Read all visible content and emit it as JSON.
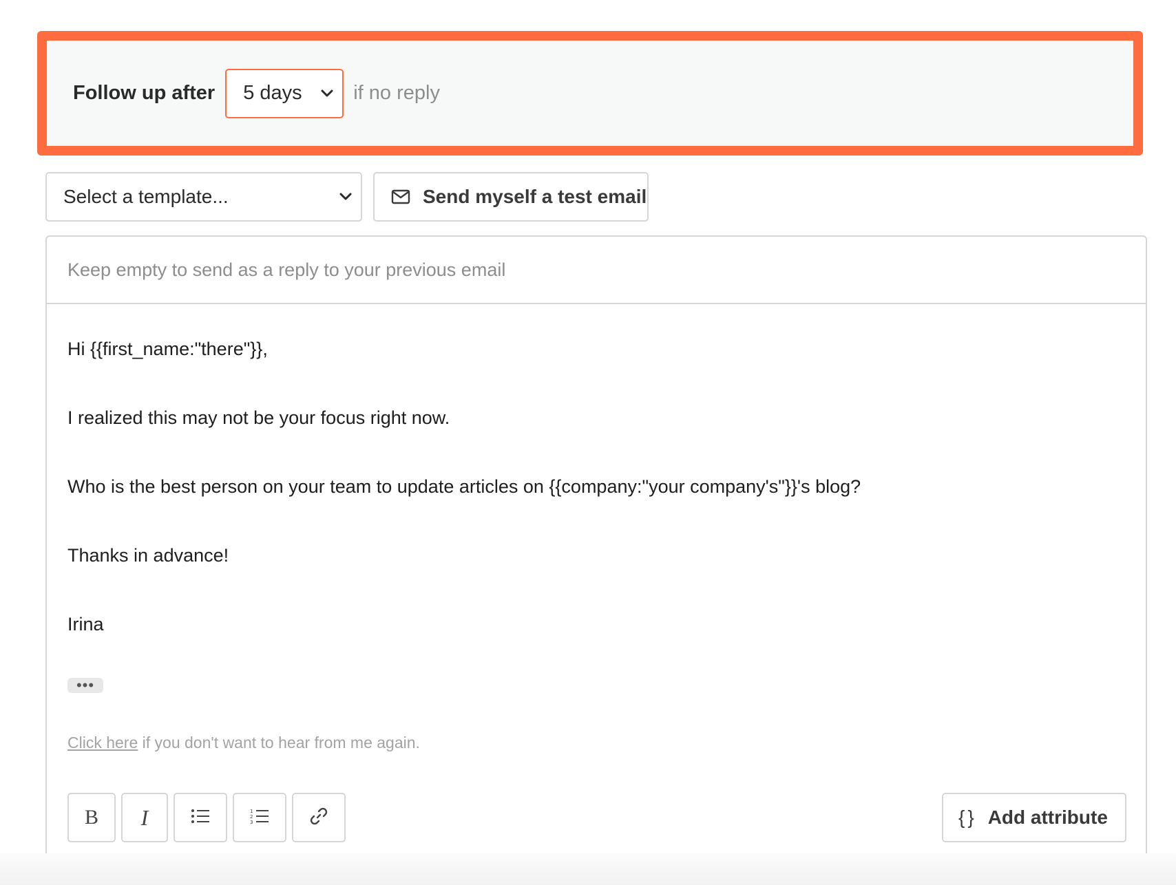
{
  "followup": {
    "label": "Follow up after",
    "delay_value": "5 days",
    "suffix": "if no reply"
  },
  "template": {
    "select_placeholder": "Select a template..."
  },
  "test_email": {
    "label": "Send myself a test email",
    "icon": "envelope-icon"
  },
  "editor": {
    "subject_placeholder": "Keep empty to send as a reply to your previous email",
    "body": [
      "Hi {{first_name:\"there\"}},",
      "I realized this may not be your focus right now.",
      "Who is the best person on your team to update articles on {{company:\"your company's\"}}'s blog?",
      "Thanks in advance!",
      "Irina"
    ],
    "ellipsis": "•••",
    "unsubscribe": {
      "link_text": "Click here",
      "rest_text": " if you don't want to hear from me again."
    }
  },
  "toolbar": {
    "bold": "B",
    "italic": "I",
    "add_attribute_braces": "{}",
    "add_attribute_label": "Add attribute"
  },
  "colors": {
    "accent": "#ff6c3f",
    "border": "#d6d6d6",
    "muted_text": "#8d8d8d"
  }
}
